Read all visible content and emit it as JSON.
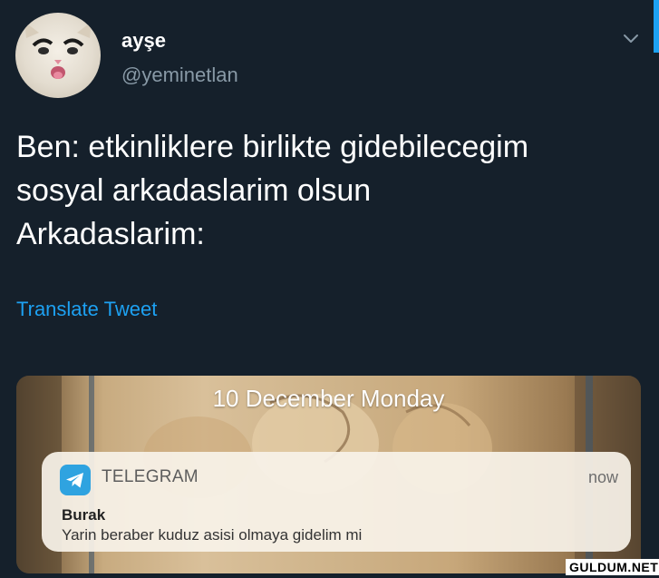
{
  "profile": {
    "name": "ayşe",
    "handle": "@yeminetlan"
  },
  "tweet": {
    "lines": [
      "Ben: etkinliklere birlikte gidebilecegim",
      "sosyal arkadaslarim olsun",
      "Arkadaslarim:"
    ],
    "translate_label": "Translate Tweet"
  },
  "media": {
    "lockscreen_date": "10 December Monday",
    "notification": {
      "app_name": "TELEGRAM",
      "time": "now",
      "sender": "Burak",
      "message": "Yarin beraber kuduz asisi olmaya gidelim mi"
    }
  },
  "watermark": "GULDUM.NET",
  "icons": {
    "menu": "chevron-down-icon",
    "app": "telegram-icon"
  },
  "colors": {
    "background": "#15202b",
    "link": "#1da1f2",
    "secondary_text": "#8899a6",
    "telegram": "#2fa3e0"
  }
}
